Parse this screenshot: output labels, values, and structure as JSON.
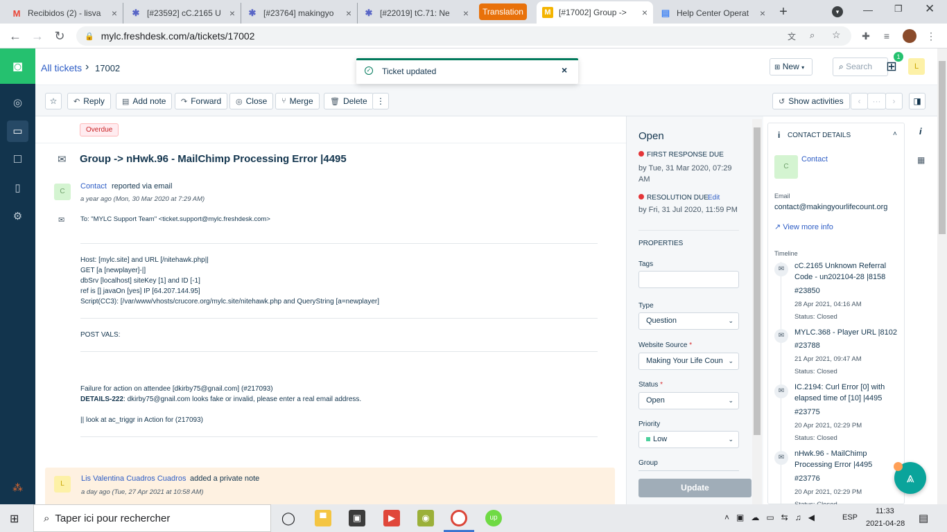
{
  "browser": {
    "tabs": [
      {
        "icon": "gmail-icon",
        "title": "Recibidos (2) - lisva",
        "icon_char": "M",
        "icon_color": "#ea4335"
      },
      {
        "icon": "freshdesk-gear-icon",
        "title": "[#23592] cC.2165 U",
        "icon_char": "✱",
        "icon_color": "#5865c6"
      },
      {
        "icon": "freshdesk-gear-icon",
        "title": "[#23764] makingyo",
        "icon_char": "✱",
        "icon_color": "#5865c6"
      },
      {
        "icon": "freshdesk-gear-icon",
        "title": "[#22019] tC.71: Ne",
        "icon_char": "✱",
        "icon_color": "#5865c6"
      },
      {
        "title": "Translation"
      },
      {
        "icon": "freshdesk-m-icon",
        "title": "[#17002] Group ->",
        "icon_char": "M",
        "icon_color": "#f4b400"
      },
      {
        "icon": "docs-icon",
        "title": "Help Center Operat",
        "icon_char": "▤",
        "icon_color": "#4285f4"
      }
    ],
    "new_tab": "+",
    "url": "mylc.freshdesk.com/a/tickets/17002"
  },
  "header": {
    "breadcrumb_root": "All tickets",
    "breadcrumb_sep": "›",
    "ticket_id": "17002",
    "new_button": "New",
    "search": "Search",
    "gift_badge": "1",
    "avatar": "L"
  },
  "toast": {
    "text": "Ticket updated",
    "close": "×"
  },
  "toolbar": {
    "reply": "Reply",
    "add_note": "Add note",
    "forward": "Forward",
    "close": "Close",
    "merge": "Merge",
    "delete": "Delete",
    "more": "⋮",
    "show_activities": "Show activities",
    "pager_dots": "···"
  },
  "ticket": {
    "overdue": "Overdue",
    "subject": "Group -> nHwk.96 - MailChimp Processing Error |4495",
    "requester_avatar": "C",
    "requester": "Contact",
    "reported_via": "reported via email",
    "time_ago": "a year ago (Mon, 30 Mar 2020 at 7:29 AM)",
    "to_line": "To: \"MYLC Support Team\" <ticket.support@mylc.freshdesk.com>",
    "body_block1": [
      "Host: [mylc.site] and URL [/nitehawk.php||",
      "GET [a [newplayer]-|]",
      "dbSrv [localhost] siteKey [1] and ID [-1]",
      "ref is [] javaOn [yes] IP [64.207.144.95]",
      "Script(CC3): [/var/www/vhosts/crucore.org/mylc.site/nitehawk.php and QueryString [a=newplayer]"
    ],
    "post_vals": "POST VALS:",
    "failure_line": "Failure for action on attendee [dkirby75@gnail.com] (#217093)",
    "details_label": "DETAILS-222",
    "details_text": ": dkirby75@gnail.com looks fake or invalid, please enter a real email address.",
    "look_line": "|| look at ac_triggr in Action for (217093)",
    "note_avatar": "L",
    "note_author": "Lis Valentina Cuadros Cuadros",
    "note_action": "added a private note",
    "note_time": "a day ago (Tue, 27 Apr 2021 at 10:58 AM)"
  },
  "properties": {
    "status_title": "Open",
    "first_response_label": "FIRST RESPONSE DUE",
    "first_response_value": "by Tue, 31 Mar 2020, 07:29 AM",
    "resolution_label": "RESOLUTION DUE",
    "edit": "Edit",
    "resolution_value": "by Fri, 31 Jul 2020, 11:59 PM",
    "section": "PROPERTIES",
    "tags_label": "Tags",
    "type_label": "Type",
    "type_value": "Question",
    "website_label": "Website Source",
    "website_value": "Making Your Life Coun",
    "status_label": "Status",
    "status_value": "Open",
    "priority_label": "Priority",
    "priority_value": "Low",
    "group_label": "Group",
    "required": "*",
    "update_button": "Update"
  },
  "contact": {
    "header": "CONTACT DETAILS",
    "avatar": "C",
    "name": "Contact",
    "email_label": "Email",
    "email": "contact@makingyourlifecount.org",
    "view_more": "View more info",
    "timeline_label": "Timeline",
    "timeline": [
      {
        "title": "cC.2165 Unknown Referral Code - un202104-28 |8158",
        "id": "#23850",
        "date": "28 Apr 2021, 04:16 AM",
        "status": "Status: Closed"
      },
      {
        "title": "MYLC.368 - Player URL |8102",
        "id": "#23788",
        "date": "21 Apr 2021, 09:47 AM",
        "status": "Status: Closed"
      },
      {
        "title": "IC.2194: Curl Error [0] with elapsed time of [10] |4495",
        "id": "#23775",
        "date": "20 Apr 2021, 02:29 PM",
        "status": "Status: Closed"
      },
      {
        "title": "nHwk.96 - MailChimp Processing Error |4495",
        "id": "#23776",
        "date": "20 Apr 2021, 02:29 PM",
        "status": "Status: Closed"
      }
    ]
  },
  "taskbar": {
    "search_placeholder": "Taper ici pour rechercher",
    "lang": "ESP",
    "time": "11:33",
    "date": "2021-04-28"
  },
  "colors": {
    "sidebar": "#12344d",
    "brand_green": "#25c16f",
    "link": "#2c5cc5",
    "overdue": "#e43538",
    "translation_tab": "#e8710a"
  }
}
